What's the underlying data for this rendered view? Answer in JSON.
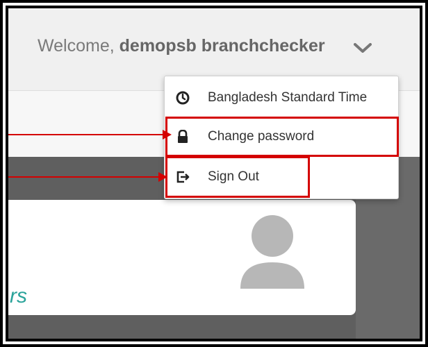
{
  "header": {
    "welcome_prefix": "Welcome, ",
    "user_name": "demopsb branchchecker"
  },
  "menu": {
    "items": [
      {
        "label": "Bangladesh Standard Time",
        "icon": "clock-icon"
      },
      {
        "label": "Change password",
        "icon": "lock-icon"
      },
      {
        "label": "Sign Out",
        "icon": "sign-out-icon"
      }
    ]
  },
  "card": {
    "partial_text": "rs"
  },
  "colors": {
    "highlight": "#d40000",
    "card_text": "#2aa39a",
    "avatar": "#b7b7b7"
  }
}
